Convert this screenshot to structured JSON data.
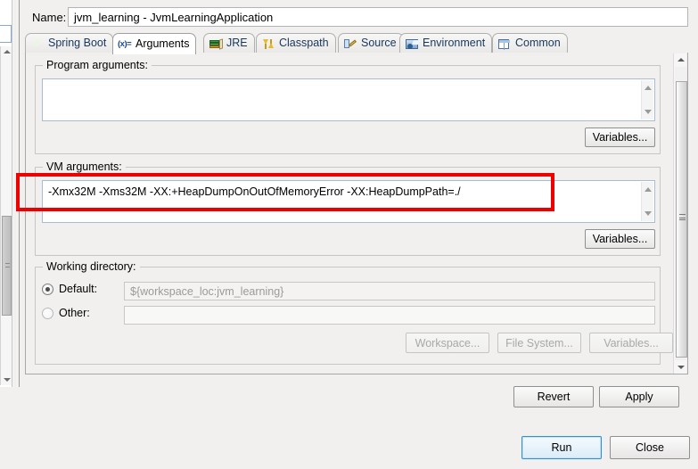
{
  "window": {
    "name_label": "Name:",
    "name_value": "jvm_learning - JvmLearningApplication"
  },
  "tabs": [
    {
      "label": "Spring Boot",
      "icon": "spring-boot-icon",
      "active": false
    },
    {
      "label": "Arguments",
      "icon": "arguments-variable-icon",
      "active": true
    },
    {
      "label": "JRE",
      "icon": "jre-books-icon",
      "active": false
    },
    {
      "label": "Classpath",
      "icon": "classpath-arrows-icon",
      "active": false
    },
    {
      "label": "Source",
      "icon": "source-pencil-icon",
      "active": false
    },
    {
      "label": "Environment",
      "icon": "environment-icon",
      "active": false
    },
    {
      "label": "Common",
      "icon": "common-table-icon",
      "active": false
    }
  ],
  "program_arguments": {
    "legend": "Program arguments:",
    "value": "",
    "variables_button": "Variables..."
  },
  "vm_arguments": {
    "legend": "VM arguments:",
    "value": "-Xmx32M -Xms32M -XX:+HeapDumpOnOutOfMemoryError -XX:HeapDumpPath=./",
    "variables_button": "Variables...",
    "highlight_color": "#ef0000"
  },
  "working_directory": {
    "legend": "Working directory:",
    "default_radio_label": "Default:",
    "default_value": "${workspace_loc:jvm_learning}",
    "default_selected": true,
    "other_radio_label": "Other:",
    "other_value": "",
    "other_selected": false,
    "workspace_button": "Workspace...",
    "file_system_button": "File System...",
    "variables_button": "Variables...",
    "buttons_enabled": false
  },
  "footer": {
    "revert_button": "Revert",
    "apply_button": "Apply",
    "run_button": "Run",
    "close_button": "Close",
    "focus_accent": "#2f8fd8"
  }
}
